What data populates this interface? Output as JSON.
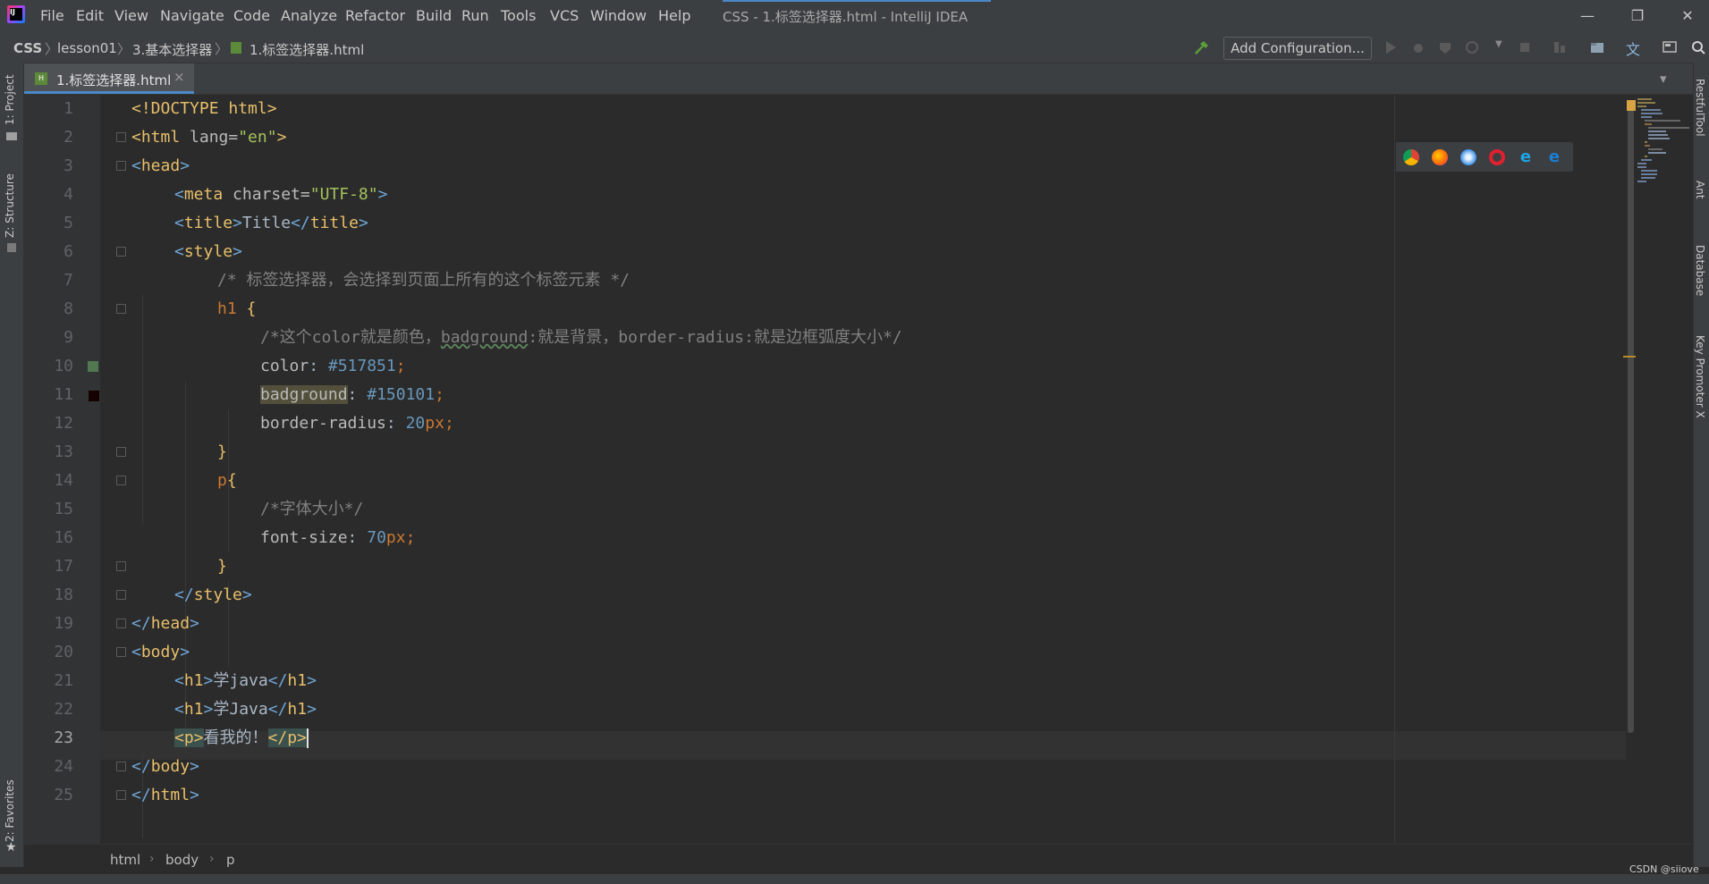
{
  "app": {
    "window_title": "CSS - 1.标签选择器.html - IntelliJ IDEA",
    "menu": [
      "File",
      "Edit",
      "View",
      "Navigate",
      "Code",
      "Analyze",
      "Refactor",
      "Build",
      "Run",
      "Tools",
      "VCS",
      "Window",
      "Help"
    ],
    "window_controls": {
      "minimize": "—",
      "maximize": "❐",
      "close": "✕"
    }
  },
  "navbar": {
    "breadcrumb": [
      "CSS",
      "lesson01",
      "3.基本选择器",
      "1.标签选择器.html"
    ],
    "add_configuration": "Add Configuration..."
  },
  "left_tool_tabs": [
    "1: Project",
    "Z: Structure",
    "2: Favorites"
  ],
  "right_tool_tabs": [
    "RestfulTool",
    "Ant",
    "Database",
    "Key Promoter X"
  ],
  "editor_tab": {
    "label": "1.标签选择器.html",
    "close": "×"
  },
  "line_numbers": [
    "1",
    "2",
    "3",
    "4",
    "5",
    "6",
    "7",
    "8",
    "9",
    "10",
    "11",
    "12",
    "13",
    "14",
    "15",
    "16",
    "17",
    "18",
    "19",
    "20",
    "21",
    "22",
    "23",
    "24",
    "25"
  ],
  "code": {
    "l1": {
      "a": "<!DOCTYPE html>"
    },
    "l2": {
      "a": "<html ",
      "b": "lang=",
      "c": "\"en\"",
      "d": ">"
    },
    "l3": {
      "a": "<",
      "b": "head",
      "c": ">"
    },
    "l4": {
      "a": "<",
      "b": "meta ",
      "c": "charset=",
      "d": "\"UTF-8\"",
      "e": ">"
    },
    "l5": {
      "a": "<",
      "b": "title",
      "c": ">",
      "d": "Title",
      "e": "</",
      "f": "title",
      "g": ">"
    },
    "l6": {
      "a": "<",
      "b": "style",
      "c": ">"
    },
    "l7": {
      "a": "/* 标签选择器，会选择到页面上所有的这个标签元素 */"
    },
    "l8": {
      "a": "h1 ",
      "b": "{"
    },
    "l9": {
      "a": "/*这个color就是颜色，",
      "b": "badground",
      "c": ":就是背景，border-radius:就是边框弧度大小*/"
    },
    "l10": {
      "a": "color",
      "b": ": ",
      "c": "#517851",
      "d": ";"
    },
    "l11": {
      "a": "badground",
      "b": ": ",
      "c": "#150101",
      "d": ";"
    },
    "l12": {
      "a": "border-radius",
      "b": ": ",
      "c": "20",
      "d": "px",
      "e": ";"
    },
    "l13": {
      "a": "}"
    },
    "l14": {
      "a": "p",
      "b": "{"
    },
    "l15": {
      "a": "/*字体大小*/"
    },
    "l16": {
      "a": "font-size",
      "b": ": ",
      "c": "70",
      "d": "px",
      "e": ";"
    },
    "l17": {
      "a": "}"
    },
    "l18": {
      "a": "</",
      "b": "style",
      "c": ">"
    },
    "l19": {
      "a": "</",
      "b": "head",
      "c": ">"
    },
    "l20": {
      "a": "<",
      "b": "body",
      "c": ">"
    },
    "l21": {
      "a": "<",
      "b": "h1",
      "c": ">",
      "d": "学java",
      "e": "</",
      "f": "h1",
      "g": ">"
    },
    "l22": {
      "a": "<",
      "b": "h1",
      "c": ">",
      "d": "学Java",
      "e": "</",
      "f": "h1",
      "g": ">"
    },
    "l23": {
      "a": "<p>",
      "b": "看我的！",
      "c": "</p>"
    },
    "l24": {
      "a": "</",
      "b": "body",
      "c": ">"
    },
    "l25": {
      "a": "</",
      "b": "html",
      "c": ">"
    }
  },
  "color_swatches": {
    "line10": "#517851",
    "line11": "#150101"
  },
  "browser_icons": [
    "chrome-icon",
    "firefox-icon",
    "safari-icon",
    "opera-icon",
    "ie-icon",
    "edge-icon"
  ],
  "bottom_breadcrumb": [
    "html",
    "body",
    "p"
  ],
  "watermark": "CSDN @siiove"
}
